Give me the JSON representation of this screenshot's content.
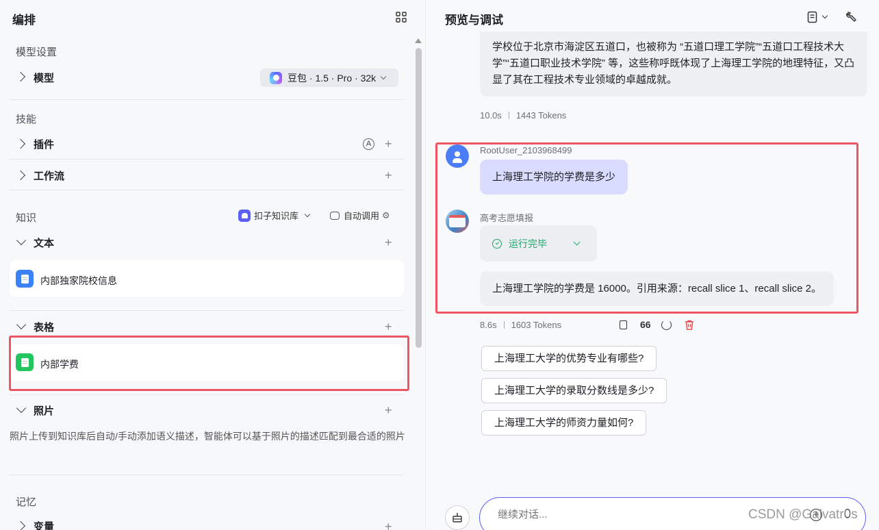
{
  "left": {
    "title": "编排",
    "model_section": {
      "title": "模型设置",
      "model_label": "模型",
      "model_value": "豆包 · 1.5 · Pro · 32k"
    },
    "skills_section": {
      "title": "技能",
      "plugins_label": "插件",
      "plugins_badge": "A",
      "workflow_label": "工作流"
    },
    "knowledge_section": {
      "title": "知识",
      "kb_dropdown": "扣子知识库",
      "auto_call": "自动调用",
      "text_label": "文本",
      "text_items": [
        {
          "name": "内部独家院校信息"
        }
      ],
      "table_label": "表格",
      "table_items": [
        {
          "name": "内部学费"
        }
      ],
      "photo_label": "照片",
      "photo_desc": "照片上传到知识库后自动/手动添加语义描述，智能体可以基于照片的描述匹配到最合适的照片"
    },
    "memory_section": {
      "title": "记忆",
      "variables_label": "变量"
    },
    "plus_symbol": "+"
  },
  "right": {
    "title": "预览与调试",
    "prev_answer": "学校位于北京市海淀区五道口，也被称为 “五道口理工学院”“五道口工程技术大学”“五道口职业技术学院” 等，这些称呼既体现了上海理工学院的地理特征，又凸显了其在工程技术专业领域的卓越成就。",
    "prev_meta": {
      "time": "10.0s",
      "tokens": "1443 Tokens"
    },
    "user_name": "RootUser_2103968499",
    "user_message": "上海理工学院的学费是多少",
    "bot_name": "高考志愿填报",
    "run_status": "运行完毕",
    "bot_answer": "上海理工学院的学费是 16000。引用来源：recall slice 1、recall slice 2。",
    "answer_meta": {
      "time": "8.6s",
      "tokens": "1603 Tokens",
      "quote_icon_text": "66"
    },
    "suggestions": [
      "上海理工大学的优势专业有哪些?",
      "上海理工大学的录取分数线是多少?",
      "上海理工大学的师资力量如何?"
    ],
    "input_placeholder": "继续对话...",
    "watermark": "CSDN @Galvatr0s"
  },
  "colors": {
    "highlight_red": "#ee5563",
    "user_bubble": "#d9dcff",
    "bot_bubble": "#eef0f4",
    "success_green": "#1aa866",
    "danger_red": "#e5484d"
  }
}
